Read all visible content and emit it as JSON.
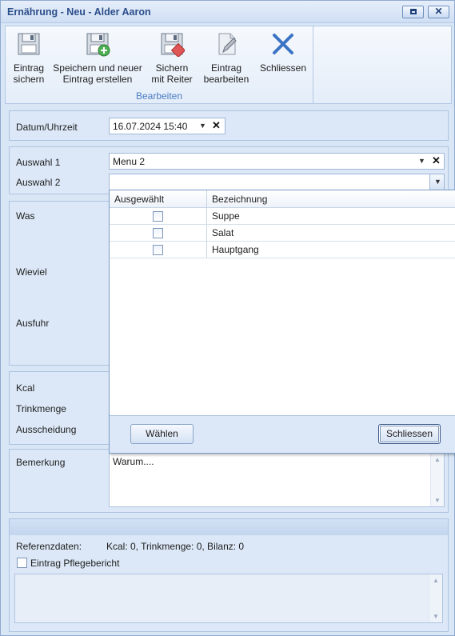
{
  "window": {
    "title": "Ernährung - Neu - Alder Aaron"
  },
  "ribbon": {
    "group_label": "Bearbeiten",
    "buttons": [
      {
        "label": "Eintrag\nsichern",
        "icon": "floppy-disk-icon"
      },
      {
        "label": "Speichern und neuer\nEintrag erstellen",
        "icon": "floppy-disk-add-icon"
      },
      {
        "label": "Sichern\nmit Reiter",
        "icon": "floppy-disk-tag-icon"
      },
      {
        "label": "Eintrag\nbearbeiten",
        "icon": "edit-document-icon"
      },
      {
        "label": "Schliessen",
        "icon": "close-x-icon"
      }
    ]
  },
  "form": {
    "datetime_label": "Datum/Uhrzeit",
    "datetime_value": "16.07.2024 15:40",
    "auswahl1_label": "Auswahl 1",
    "auswahl1_value": "Menu 2",
    "auswahl2_label": "Auswahl 2",
    "auswahl2_value": "",
    "was_label": "Was",
    "wieviel_label": "Wieviel",
    "ausfuhr_label": "Ausfuhr",
    "kcal_label": "Kcal",
    "trinkmenge_label": "Trinkmenge",
    "ausscheidung_label": "Ausscheidung",
    "bemerkung_label": "Bemerkung",
    "bemerkung_value": "Warum....",
    "referenz_label": "Referenzdaten:",
    "referenz_value": "Kcal: 0, Trinkmenge: 0, Bilanz: 0",
    "pflegebericht_label": "Eintrag Pflegebericht"
  },
  "popup": {
    "headers": [
      "Ausgewählt",
      "Bezeichnung"
    ],
    "rows": [
      {
        "checked": false,
        "name": "Suppe"
      },
      {
        "checked": false,
        "name": "Salat"
      },
      {
        "checked": false,
        "name": "Hauptgang"
      }
    ],
    "choose_label": "Wählen",
    "close_label": "Schliessen"
  }
}
